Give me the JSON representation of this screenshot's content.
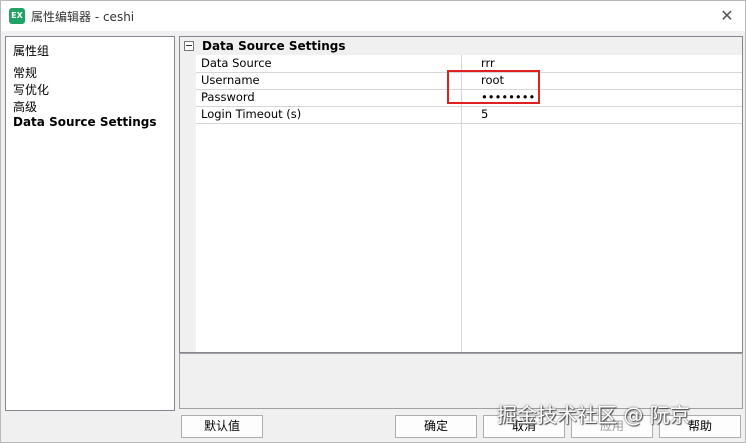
{
  "window": {
    "title": "属性编辑器 - ceshi",
    "app_icon_text": "EX",
    "close_glyph": "✕"
  },
  "groups": {
    "header": "属性组",
    "items": [
      "常规",
      "写优化",
      "高级",
      "Data Source Settings"
    ],
    "selected_index": 3
  },
  "grid": {
    "category": "Data Source Settings",
    "properties": [
      {
        "name": "Data Source",
        "value": "rrr"
      },
      {
        "name": "Username",
        "value": "root"
      },
      {
        "name": "Password",
        "value": "••••••••"
      },
      {
        "name": "Login Timeout (s)",
        "value": "5"
      }
    ]
  },
  "buttons": {
    "default": "默认值",
    "ok": "确定",
    "cancel": "取消",
    "apply": "应用",
    "help": "帮助"
  },
  "watermark": "掘金技术社区 @ 阮京",
  "colors": {
    "highlight": "#e0201f",
    "app_icon": "#21a366"
  }
}
